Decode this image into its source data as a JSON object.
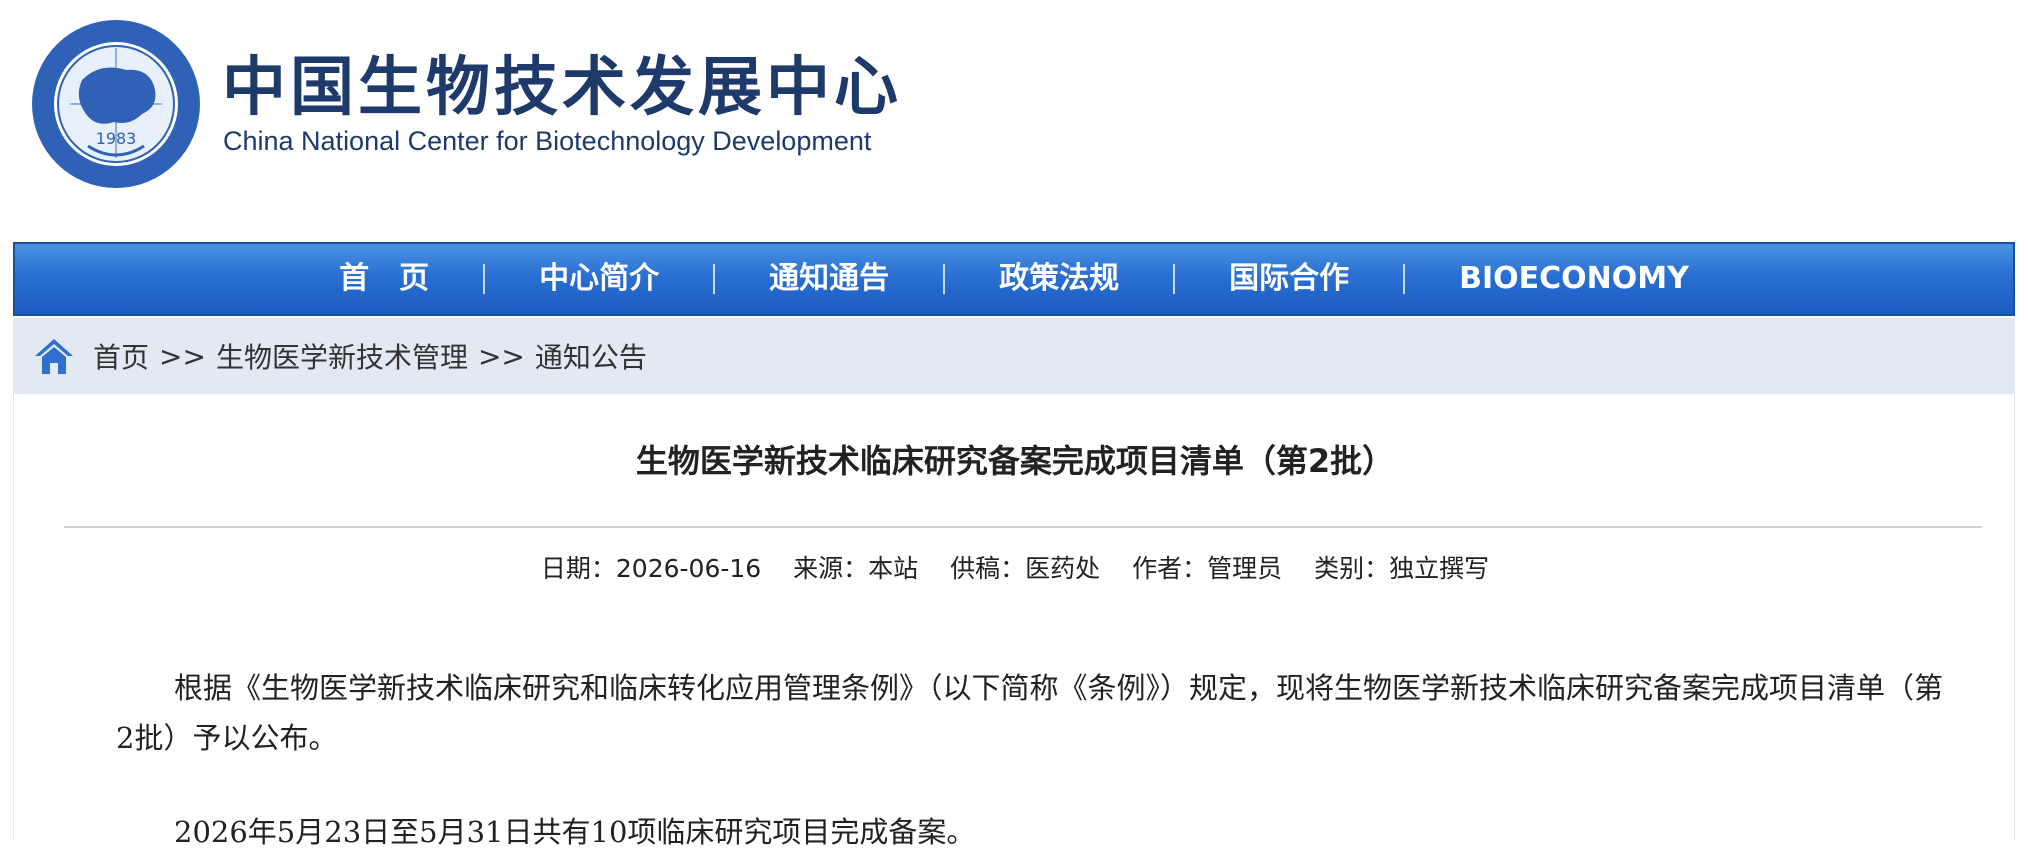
{
  "header": {
    "logo_emblem": {
      "icon": "organization-emblem-icon",
      "year": "1983"
    },
    "title_cn": "中国生物技术发展中心",
    "title_en": "China National Center for Biotechnology Development"
  },
  "nav": {
    "items": [
      {
        "label": "首　页"
      },
      {
        "label": "中心简介"
      },
      {
        "label": "通知通告"
      },
      {
        "label": "政策法规"
      },
      {
        "label": "国际合作"
      },
      {
        "label": "BIOECONOMY"
      }
    ],
    "colors": {
      "bar_top": "#4a93e4",
      "bar_bottom": "#1c5cc2"
    }
  },
  "breadcrumb": {
    "icon": "home-icon",
    "items": [
      "首页",
      "生物医学新技术管理",
      "通知公告"
    ],
    "separator": ">>"
  },
  "article": {
    "title": "生物医学新技术临床研究备案完成项目清单（第2批）",
    "meta": {
      "date": "日期：2026-06-16",
      "source": "来源：本站",
      "contributor": "供稿：医药处",
      "author": "作者：管理员",
      "category": "类别：独立撰写"
    },
    "paragraphs": [
      "根据《生物医学新技术临床研究和临床转化应用管理条例》（以下简称《条例》）规定，现将生物医学新技术临床研究备案完成项目清单（第2批）予以公布。",
      "2026年5月23日至5月31日共有10项临床研究项目完成备案。"
    ]
  }
}
